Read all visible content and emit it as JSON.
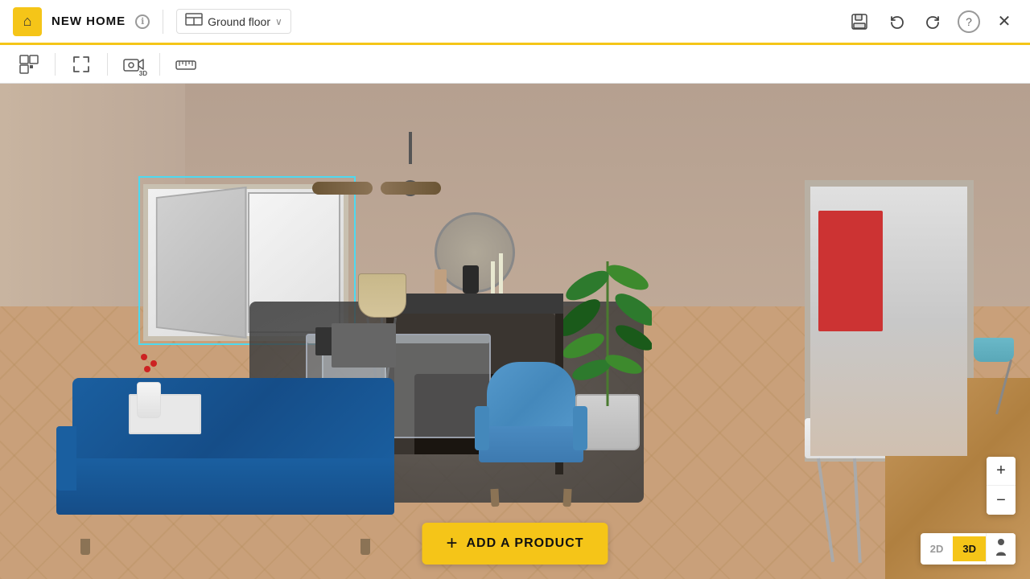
{
  "app": {
    "logo_symbol": "⌂",
    "title": "NEW HOME",
    "info_icon": "ℹ",
    "floor_label": "Ground floor",
    "floor_icon": "⬡",
    "chevron": "∨"
  },
  "topbar": {
    "save_icon": "💾",
    "undo_icon": "↩",
    "redo_icon": "↪",
    "help_icon": "?",
    "close_icon": "✕"
  },
  "toolbar": {
    "grid_icon": "⊞",
    "fullscreen_icon": "⤢",
    "camera_icon": "📷",
    "ruler_icon": "📏"
  },
  "canvas": {
    "add_product_label": "ADD A PRODUCT",
    "add_product_plus": "+"
  },
  "zoom": {
    "plus_label": "+",
    "minus_label": "−"
  },
  "view_toggle": {
    "option_2d": "2D",
    "option_3d": "3D",
    "person_icon": "👤"
  }
}
